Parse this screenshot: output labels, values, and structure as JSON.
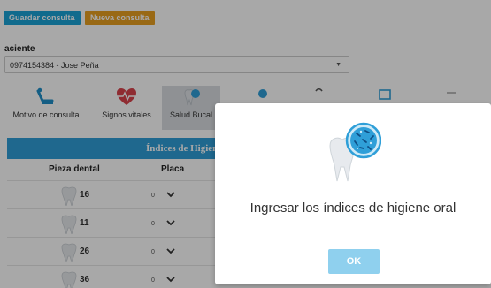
{
  "toolbar": {
    "save_label": "Guardar consulta",
    "new_label": "Nueva consulta",
    "save_color": "#1aa3d6",
    "new_color": "#e8a020"
  },
  "patient": {
    "label": "aciente",
    "value": "0974154384 - Jose Peña"
  },
  "tabs": [
    {
      "label": "Motivo de consulta",
      "icon": "dental-chair-icon",
      "active": false
    },
    {
      "label": "Signos vitales",
      "icon": "heartbeat-icon",
      "active": false
    },
    {
      "label": "Salud Bucal",
      "icon": "tooth-brush-icon",
      "active": true
    },
    {
      "label": "",
      "icon": "tooth-search-icon",
      "active": false
    },
    {
      "label": "",
      "icon": "dental-tool-icon",
      "active": false
    },
    {
      "label": "",
      "icon": "calendar-icon",
      "active": false
    },
    {
      "label": "",
      "icon": "chair-icon",
      "active": false
    }
  ],
  "section": {
    "title": "Índices de Higiene",
    "bar_color": "#2f9fd8"
  },
  "table": {
    "col_tooth": "Pieza dental",
    "col_plaque": "Placa",
    "rows": [
      {
        "tooth": "16",
        "plaque": "0"
      },
      {
        "tooth": "11",
        "plaque": "0"
      },
      {
        "tooth": "26",
        "plaque": "0"
      },
      {
        "tooth": "36",
        "plaque": "0"
      }
    ]
  },
  "modal": {
    "title": "Ingresar los índices de higiene oral",
    "ok_label": "OK",
    "icon": "tooth-bacteria-icon"
  }
}
